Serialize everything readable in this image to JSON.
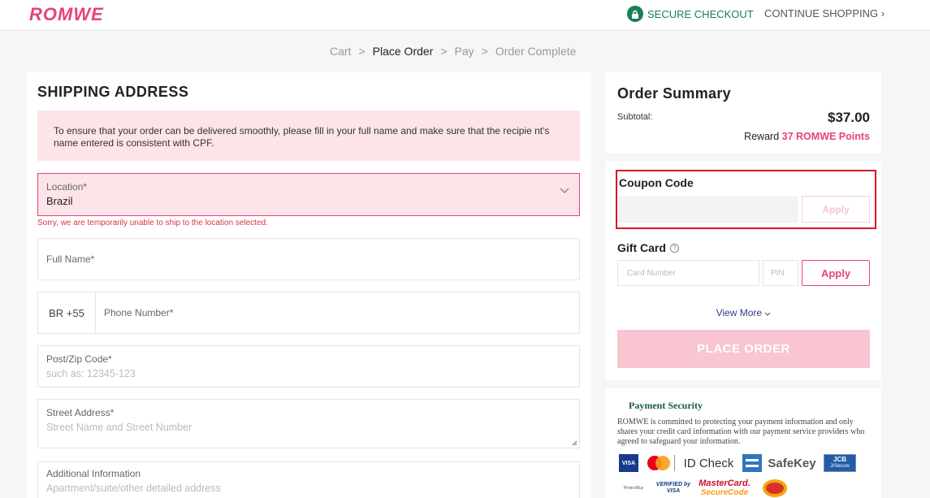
{
  "header": {
    "logo": "ROMWE",
    "secure_checkout": "SECURE CHECKOUT",
    "continue_shopping": "CONTINUE SHOPPING",
    "continue_arrow": "›"
  },
  "breadcrumb": {
    "sep": ">",
    "steps": [
      "Cart",
      "Place Order",
      "Pay",
      "Order Complete"
    ]
  },
  "shipping": {
    "title": "SHIPPING ADDRESS",
    "notice": "To ensure that your order can be delivered smoothly, please fill in your full name and make sure that the recipie nt's name entered is consistent with CPF.",
    "location_label": "Location*",
    "location_value": "Brazil",
    "location_error": "Sorry, we are temporarily unable to ship to the location selected.",
    "full_name_label": "Full Name*",
    "country_code": "BR +55",
    "phone_label": "Phone Number*",
    "zip_label": "Post/Zip Code*",
    "zip_placeholder": "such as: 12345-123",
    "street_label": "Street Address*",
    "street_placeholder": "Street Name and Street Number",
    "additional_label": "Additional Information",
    "additional_placeholder": "Apartment/suite/other detailed address"
  },
  "summary": {
    "title": "Order Summary",
    "subtotal_label": "Subtotal:",
    "subtotal_value": "$37.00",
    "reward_prefix": "Reward",
    "reward_points": "37",
    "reward_suffix": "ROMWE Points"
  },
  "coupon": {
    "title": "Coupon Code",
    "apply": "Apply"
  },
  "giftcard": {
    "title": "Gift Card",
    "help": "?",
    "card_placeholder": "Card Number",
    "pin_placeholder": "PIN",
    "apply": "Apply"
  },
  "view_more": "View More",
  "place_order": "PLACE ORDER",
  "payment_security": {
    "title": "Payment Security",
    "text": "ROMWE is committed to protecting your payment information and only shares your credit card information with our payment service providers who agreed to safeguard your information.",
    "logos": [
      "VISA",
      "ID Check",
      "SafeKey",
      "JCB",
      "J/Secure",
      "ProtectBuy",
      "VERIFIED by VISA",
      "MasterCard.",
      "SecureCode"
    ]
  },
  "colors": {
    "brand": "#e6427a",
    "secure_green": "#198055",
    "error_bg": "#fce4e8",
    "highlight_red": "#d71920"
  }
}
